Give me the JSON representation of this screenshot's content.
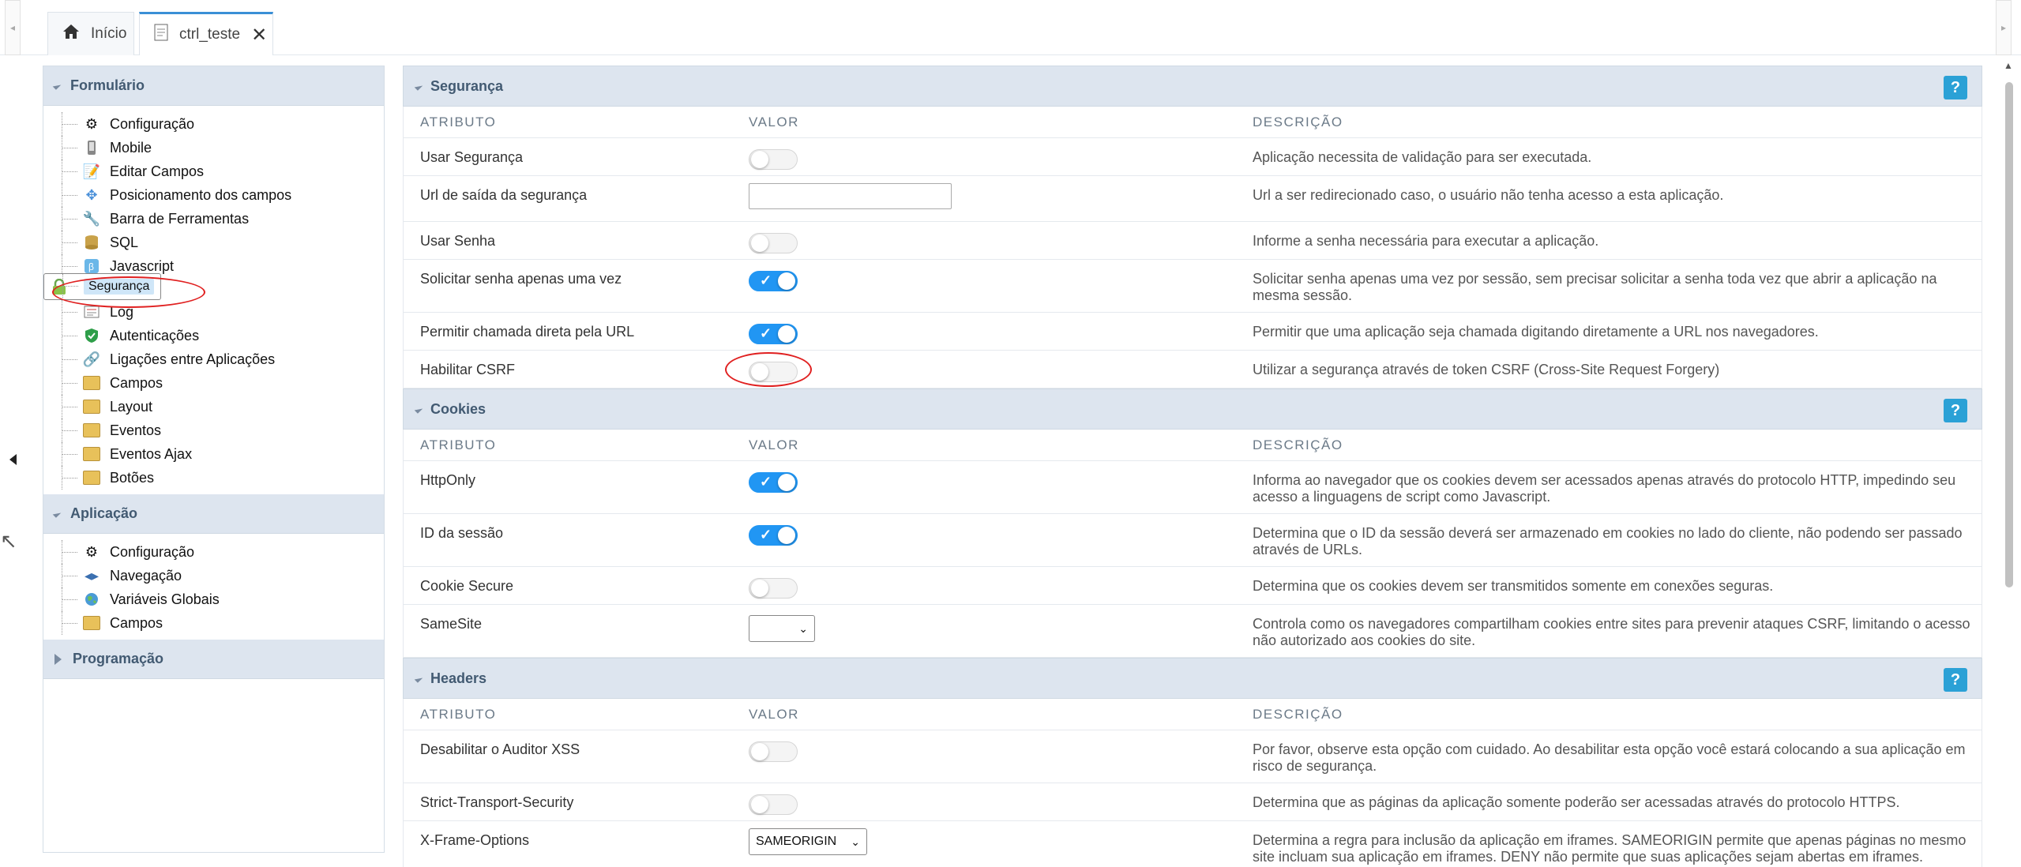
{
  "tabs": [
    {
      "label": "Início",
      "icon": "home-icon"
    },
    {
      "label": "ctrl_teste",
      "icon": "document-icon",
      "close": "✕"
    }
  ],
  "sidebar": {
    "sections": [
      {
        "title": "Formulário",
        "items": [
          {
            "label": "Configuração",
            "icon": "gear-icon"
          },
          {
            "label": "Mobile",
            "icon": "mobile-icon"
          },
          {
            "label": "Editar Campos",
            "icon": "edit-icon"
          },
          {
            "label": "Posicionamento dos campos",
            "icon": "move-icon"
          },
          {
            "label": "Barra de Ferramentas",
            "icon": "wrench-icon"
          },
          {
            "label": "SQL",
            "icon": "database-icon"
          },
          {
            "label": "Javascript",
            "icon": "javascript-icon"
          },
          {
            "label": "Segurança",
            "icon": "lock-icon"
          },
          {
            "label": "Log",
            "icon": "log-icon"
          },
          {
            "label": "Autenticações",
            "icon": "shield-check-icon"
          },
          {
            "label": "Ligações entre Aplicações",
            "icon": "link-icon"
          },
          {
            "label": "Campos",
            "icon": "folder-icon"
          },
          {
            "label": "Layout",
            "icon": "folder-icon"
          },
          {
            "label": "Eventos",
            "icon": "folder-icon"
          },
          {
            "label": "Eventos Ajax",
            "icon": "folder-icon"
          },
          {
            "label": "Botões",
            "icon": "folder-icon"
          }
        ]
      },
      {
        "title": "Aplicação",
        "items": [
          {
            "label": "Configuração",
            "icon": "gear-icon"
          },
          {
            "label": "Navegação",
            "icon": "navigation-icon"
          },
          {
            "label": "Variáveis Globais",
            "icon": "globe-icon"
          },
          {
            "label": "Campos",
            "icon": "folder-icon"
          }
        ]
      },
      {
        "title": "Programação",
        "items": []
      }
    ]
  },
  "columns": {
    "attr": "ATRIBUTO",
    "value": "VALOR",
    "desc": "DESCRIÇÃO"
  },
  "help_label": "?",
  "sections": [
    {
      "title": "Segurança",
      "rows": [
        {
          "attr": "Usar Segurança",
          "type": "toggle",
          "on": false,
          "desc": "Aplicação necessita de validação para ser executada."
        },
        {
          "attr": "Url de saída da segurança",
          "type": "text",
          "value": "",
          "desc": "Url a ser redirecionado caso, o usuário não tenha acesso a esta aplicação."
        },
        {
          "attr": "Usar Senha",
          "type": "toggle",
          "on": false,
          "desc": "Informe a senha necessária para executar a aplicação."
        },
        {
          "attr": "Solicitar senha apenas uma vez",
          "type": "toggle",
          "on": true,
          "desc": "Solicitar senha apenas uma vez por sessão, sem precisar solicitar a senha toda vez que abrir a aplicação na mesma sessão."
        },
        {
          "attr": "Permitir chamada direta pela URL",
          "type": "toggle",
          "on": true,
          "desc": "Permitir que uma aplicação seja chamada digitando diretamente a URL nos navegadores."
        },
        {
          "attr": "Habilitar CSRF",
          "type": "toggle",
          "on": false,
          "desc": "Utilizar a segurança através de token CSRF (Cross-Site Request Forgery)"
        }
      ]
    },
    {
      "title": "Cookies",
      "rows": [
        {
          "attr": "HttpOnly",
          "type": "toggle",
          "on": true,
          "desc": "Informa ao navegador que os cookies devem ser acessados apenas através do protocolo HTTP, impedindo seu acesso a linguagens de script como Javascript."
        },
        {
          "attr": "ID da sessão",
          "type": "toggle",
          "on": true,
          "desc": "Determina que o ID da sessão deverá ser armazenado em cookies no lado do cliente, não podendo ser passado através de URLs."
        },
        {
          "attr": "Cookie Secure",
          "type": "toggle",
          "on": false,
          "desc": "Determina que os cookies devem ser transmitidos somente em conexões seguras."
        },
        {
          "attr": "SameSite",
          "type": "select",
          "value": "",
          "desc": "Controla como os navegadores compartilham cookies entre sites para prevenir ataques CSRF, limitando o acesso não autorizado aos cookies do site."
        }
      ]
    },
    {
      "title": "Headers",
      "rows": [
        {
          "attr": "Desabilitar o Auditor XSS",
          "type": "toggle",
          "on": false,
          "desc": "Por favor, observe esta opção com cuidado. Ao desabilitar esta opção você estará colocando a sua aplicação em risco de segurança."
        },
        {
          "attr": "Strict-Transport-Security",
          "type": "toggle",
          "on": false,
          "desc": "Determina que as páginas da aplicação somente poderão ser acessadas através do protocolo HTTPS."
        },
        {
          "attr": "X-Frame-Options",
          "type": "select",
          "value": "SAMEORIGIN",
          "desc": "Determina a regra para inclusão da aplicação em iframes. SAMEORIGIN permite que apenas páginas no mesmo site incluam sua aplicação em iframes. DENY não permite que suas aplicações sejam abertas em iframes."
        }
      ]
    }
  ],
  "colors": {
    "accent": "#2196f3",
    "header_bg": "#dde5ef",
    "header_text": "#425a72",
    "highlight": "#e02020"
  }
}
